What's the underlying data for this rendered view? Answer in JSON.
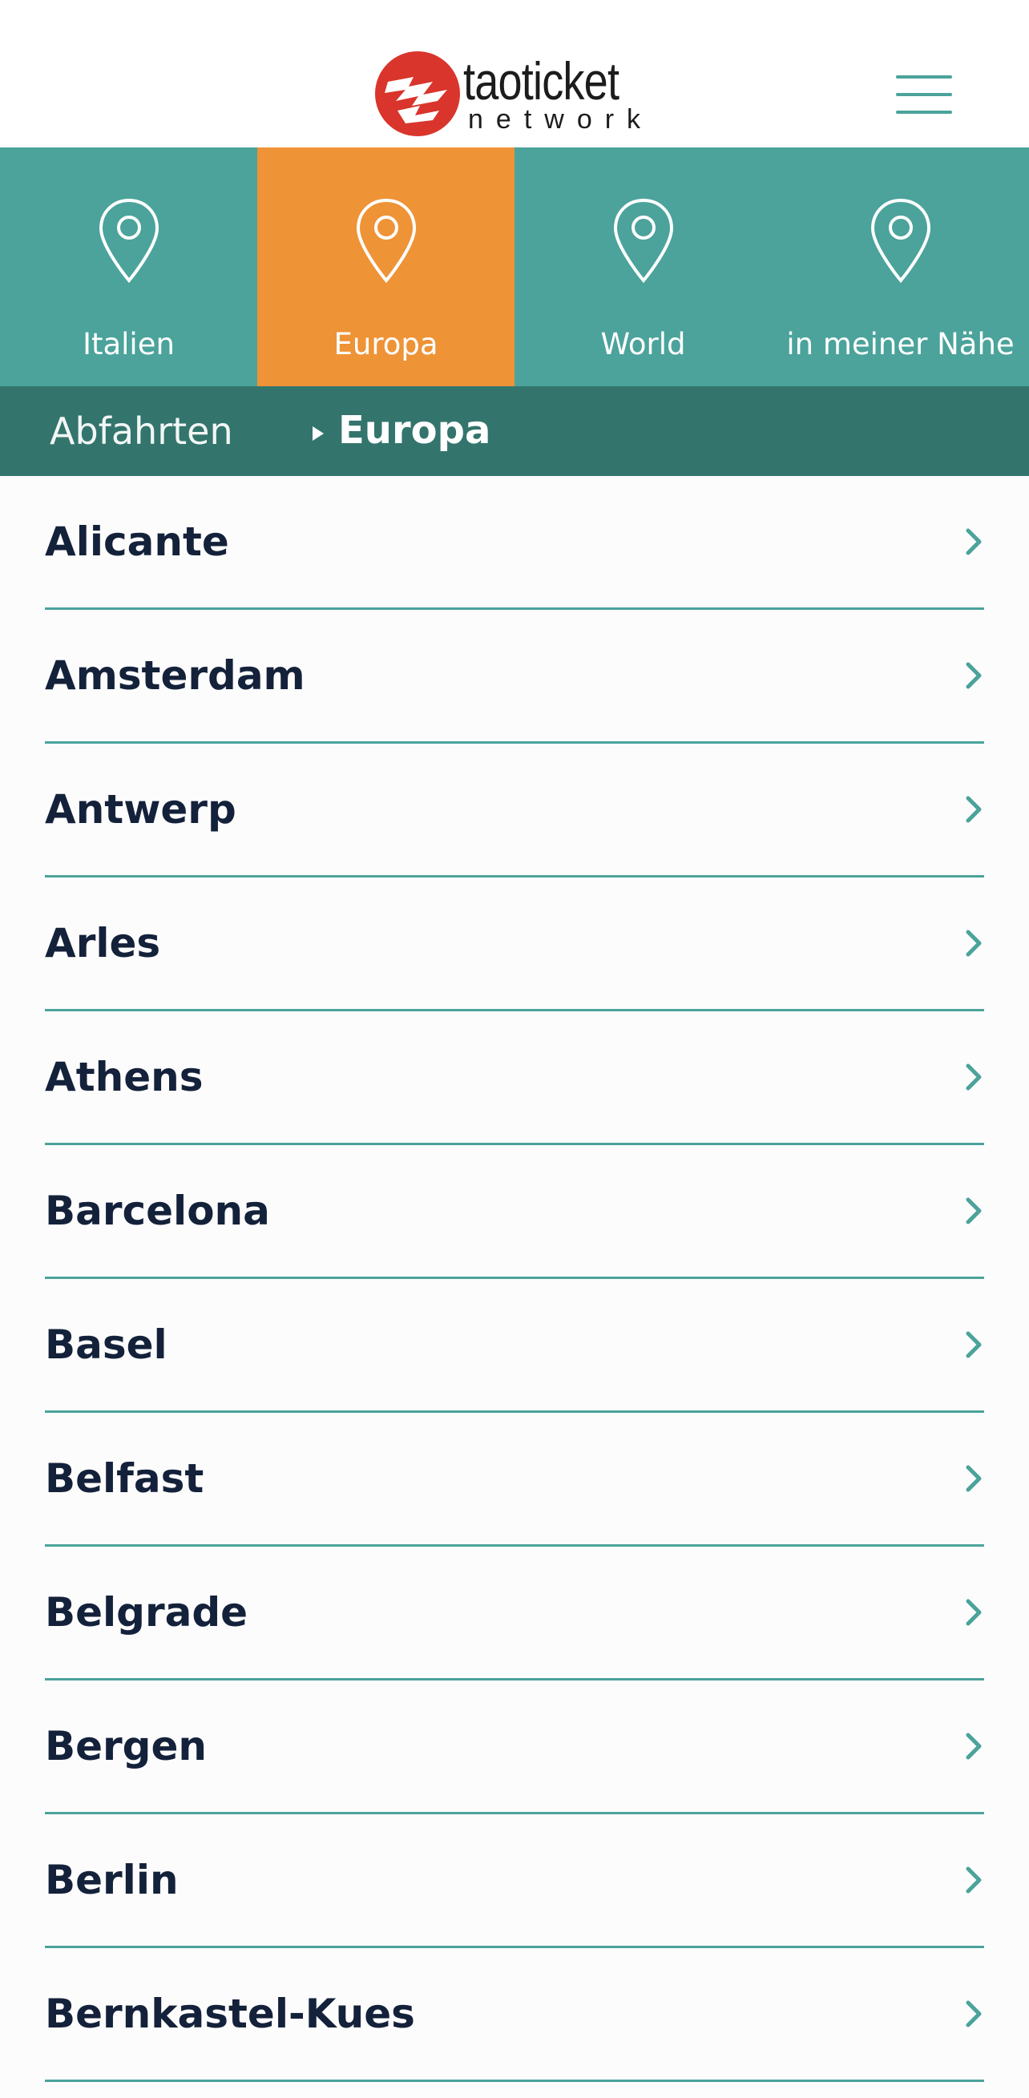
{
  "header": {
    "logo_word": "taoticket",
    "logo_sub": "network",
    "colors": {
      "logo_red": "#d9352c",
      "accent_teal": "#4ba39b"
    },
    "menu_icon": "hamburger-menu-icon"
  },
  "tabs": [
    {
      "label": "Italien",
      "icon": "map-pin-icon",
      "active": false
    },
    {
      "label": "Europa",
      "icon": "map-pin-icon",
      "active": true
    },
    {
      "label": "World",
      "icon": "map-pin-icon",
      "active": false
    },
    {
      "label": "in meiner Nähe",
      "icon": "map-pin-icon",
      "active": false
    }
  ],
  "tab_colors": {
    "default": "#4ba39b",
    "active": "#ee9336"
  },
  "breadcrumb": {
    "root": "Abfahrten",
    "current": "Europa",
    "background": "#33756d"
  },
  "cities": [
    {
      "name": "Alicante"
    },
    {
      "name": "Amsterdam"
    },
    {
      "name": "Antwerp"
    },
    {
      "name": "Arles"
    },
    {
      "name": "Athens"
    },
    {
      "name": "Barcelona"
    },
    {
      "name": "Basel"
    },
    {
      "name": "Belfast"
    },
    {
      "name": "Belgrade"
    },
    {
      "name": "Bergen"
    },
    {
      "name": "Berlin"
    },
    {
      "name": "Bernkastel-Kues"
    }
  ]
}
